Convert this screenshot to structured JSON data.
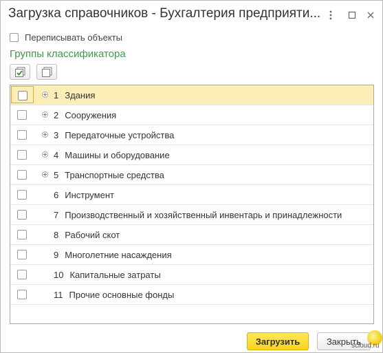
{
  "window": {
    "title": "Загрузка справочников - Бухгалтерия предприяти..."
  },
  "options": {
    "overwrite_label": "Переписывать объекты",
    "overwrite_checked": false
  },
  "groups": {
    "title": "Группы классификатора",
    "rows": [
      {
        "num": "1",
        "name": "Здания",
        "expandable": true,
        "checked": false,
        "selected": true
      },
      {
        "num": "2",
        "name": "Сооружения",
        "expandable": true,
        "checked": false
      },
      {
        "num": "3",
        "name": "Передаточные устройства",
        "expandable": true,
        "checked": false
      },
      {
        "num": "4",
        "name": "Машины и оборудование",
        "expandable": true,
        "checked": false
      },
      {
        "num": "5",
        "name": "Транспортные средства",
        "expandable": true,
        "checked": false
      },
      {
        "num": "6",
        "name": "Инструмент",
        "expandable": false,
        "checked": false
      },
      {
        "num": "7",
        "name": "Производственный и хозяйственный инвентарь и принадлежности",
        "expandable": false,
        "checked": false
      },
      {
        "num": "8",
        "name": "Рабочий скот",
        "expandable": false,
        "checked": false
      },
      {
        "num": "9",
        "name": "Многолетние насаждения",
        "expandable": false,
        "checked": false
      },
      {
        "num": "10",
        "name": "Капитальные затраты",
        "expandable": false,
        "checked": false
      },
      {
        "num": "11",
        "name": "Прочие основные фонды",
        "expandable": false,
        "checked": false
      }
    ]
  },
  "footer": {
    "load_label": "Загрузить",
    "close_label": "Закрыть",
    "watermark": "scloud.ru"
  },
  "colors": {
    "accent_green": "#3c9b4b",
    "primary_button": "#f8d41f",
    "selected_row": "#fbeeb6"
  }
}
